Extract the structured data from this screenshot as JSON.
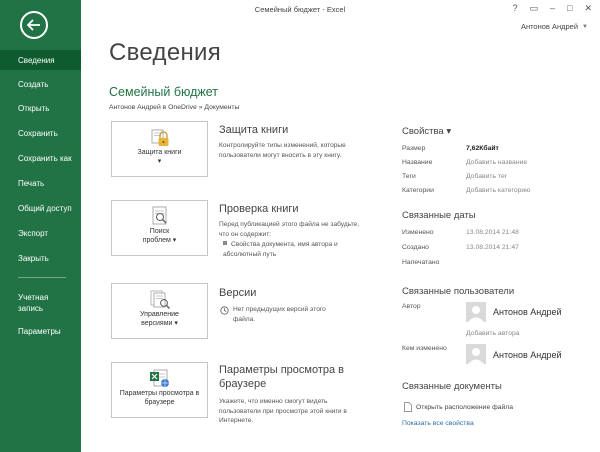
{
  "window": {
    "title": "Семейный бюджет - Excel",
    "controls": [
      "?",
      "▭",
      "–",
      "□",
      "✕"
    ],
    "user": "Антонов Андрей"
  },
  "sidebar": {
    "items": [
      {
        "label": "Сведения",
        "active": true
      },
      {
        "label": "Создать"
      },
      {
        "label": "Открыть"
      },
      {
        "label": "Сохранить"
      },
      {
        "label": "Сохранить как"
      },
      {
        "label": "Печать"
      },
      {
        "label": "Общий доступ"
      },
      {
        "label": "Экспорт"
      },
      {
        "label": "Закрыть"
      },
      {
        "label": "Учетная запись"
      },
      {
        "label": "Параметры"
      }
    ]
  },
  "main": {
    "title": "Сведения",
    "doc_name": "Семейный бюджет",
    "doc_path": "Антонов Андрей в OneDrive » Документы",
    "sections": {
      "protect": {
        "button_label": "Защита книги ▾",
        "title": "Защита книги",
        "desc": "Контролируйте типы изменений, которые пользователи могут вносить в эту книгу."
      },
      "inspect": {
        "button_label": "Поиск проблем ▾",
        "title": "Проверка книги",
        "desc": "Перед публикацией этого файла не забудьте, что он содержит:",
        "bullet": "Свойства документа, имя автора и абсолютный путь"
      },
      "versions": {
        "button_label": "Управление версиями ▾",
        "title": "Версии",
        "desc": "Нет предыдущих версий этого файла."
      },
      "browser": {
        "button_label": "Параметры просмотра в браузере",
        "title": "Параметры просмотра в браузере",
        "desc": "Укажите, что именно смогут видеть пользователи при просмотре этой книги в Интернете."
      }
    }
  },
  "properties": {
    "heading": "Свойства ▾",
    "rows": [
      {
        "label": "Размер",
        "value": "7,62Кбайт"
      },
      {
        "label": "Название",
        "value": "Добавить название"
      },
      {
        "label": "Теги",
        "value": "Добавить тег"
      },
      {
        "label": "Категории",
        "value": "Добавить категорию"
      }
    ],
    "dates_heading": "Связанные даты",
    "dates": [
      {
        "label": "Изменено",
        "value": "13.08.2014 21:48"
      },
      {
        "label": "Создано",
        "value": "13.08.2014 21:47"
      },
      {
        "label": "Напечатано",
        "value": ""
      }
    ],
    "people_heading": "Связанные пользователи",
    "author_label": "Автор",
    "author_name": "Антонов Андрей",
    "add_author": "Добавить автора",
    "modified_by_label": "Кем изменено",
    "modified_by_name": "Антонов Андрей",
    "docs_heading": "Связанные документы",
    "open_location": "Открыть расположение файла",
    "show_all": "Показать все свойства"
  },
  "colors": {
    "accent": "#217346",
    "accent_dark": "#0f5b30",
    "link": "#2e6da4"
  }
}
